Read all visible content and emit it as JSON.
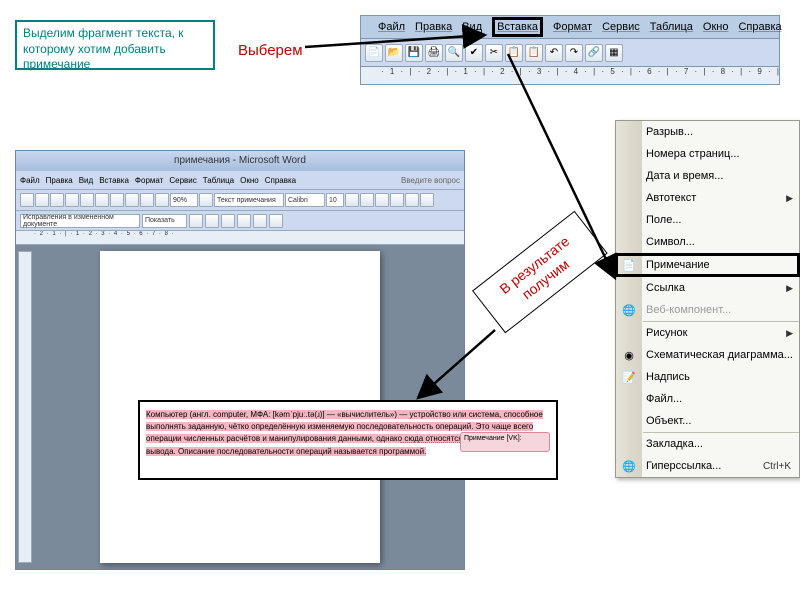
{
  "note_box": "Выделим фрагмент текста, к которому хотим добавить примечание",
  "select_label": "Выберем",
  "menubar": {
    "items": [
      "Файл",
      "Правка",
      "Вид",
      "Вставка",
      "Формат",
      "Сервис",
      "Таблица",
      "Окно",
      "Справка"
    ],
    "highlight_index": 3
  },
  "ruler_top": "· 1 · | · 2 · | · 1 · | · 2 · | · 3 · | · 4 · | · 5 · | · 6 · | · 7 · | · 8 · | · 9 · | · 10 · | · 11 · | · 12 · | · 13 · | · 14 · |",
  "dropdown": {
    "items": [
      {
        "label": "Разрыв...",
        "icon": "",
        "arrow": false
      },
      {
        "label": "Номера страниц...",
        "icon": "",
        "arrow": false
      },
      {
        "label": "Дата и время...",
        "icon": "",
        "arrow": false
      },
      {
        "label": "Автотекст",
        "icon": "",
        "arrow": true
      },
      {
        "label": "Поле...",
        "icon": "",
        "arrow": false
      },
      {
        "label": "Символ...",
        "icon": "",
        "arrow": false
      },
      {
        "sep": true
      },
      {
        "label": "Примечание",
        "icon": "📄",
        "arrow": false,
        "highlight": true
      },
      {
        "sep": true
      },
      {
        "label": "Ссылка",
        "icon": "",
        "arrow": true
      },
      {
        "label": "Веб-компонент...",
        "icon": "🌐",
        "arrow": false,
        "disabled": true
      },
      {
        "sep": true
      },
      {
        "label": "Рисунок",
        "icon": "",
        "arrow": true
      },
      {
        "label": "Схематическая диаграмма...",
        "icon": "◉",
        "arrow": false
      },
      {
        "label": "Надпись",
        "icon": "📝",
        "arrow": false
      },
      {
        "label": "Файл...",
        "icon": "",
        "arrow": false
      },
      {
        "label": "Объект...",
        "icon": "",
        "arrow": false
      },
      {
        "sep": true
      },
      {
        "label": "Закладка...",
        "icon": "",
        "arrow": false
      },
      {
        "label": "Гиперссылка...",
        "icon": "🌐",
        "arrow": false,
        "shortcut": "Ctrl+K"
      }
    ]
  },
  "word_win": {
    "title": "примечания - Microsoft Word",
    "menu": [
      "Файл",
      "Правка",
      "Вид",
      "Вставка",
      "Формат",
      "Сервис",
      "Таблица",
      "Окно",
      "Справка"
    ],
    "ask": "Введите вопрос",
    "zoom": "90%",
    "style": "Текст примечания",
    "font": "Calibri",
    "size": "10",
    "track_label": "Исправления в измененном документе",
    "show_label": "Показать",
    "ruler": "· 2 · 1 · | · 1 · 2 · 3 · 4 · 5 · 6 · 7 · 8 ·"
  },
  "result_label": "В результате получим",
  "result_text": "Компьютер (англ. computer, МФА: [kəmˈpjuː.tə(ɹ)] — «вычислитель») — устройство или система, способное выполнять заданную, чётко определённую изменяемую последовательность операций. Это чаще всего операции численных расчётов и манипулирования данными, однако сюда относятся и операции ввода-вывода. Описание последовательности операций называется программой.",
  "comment_label": "Примечание [VK]:"
}
